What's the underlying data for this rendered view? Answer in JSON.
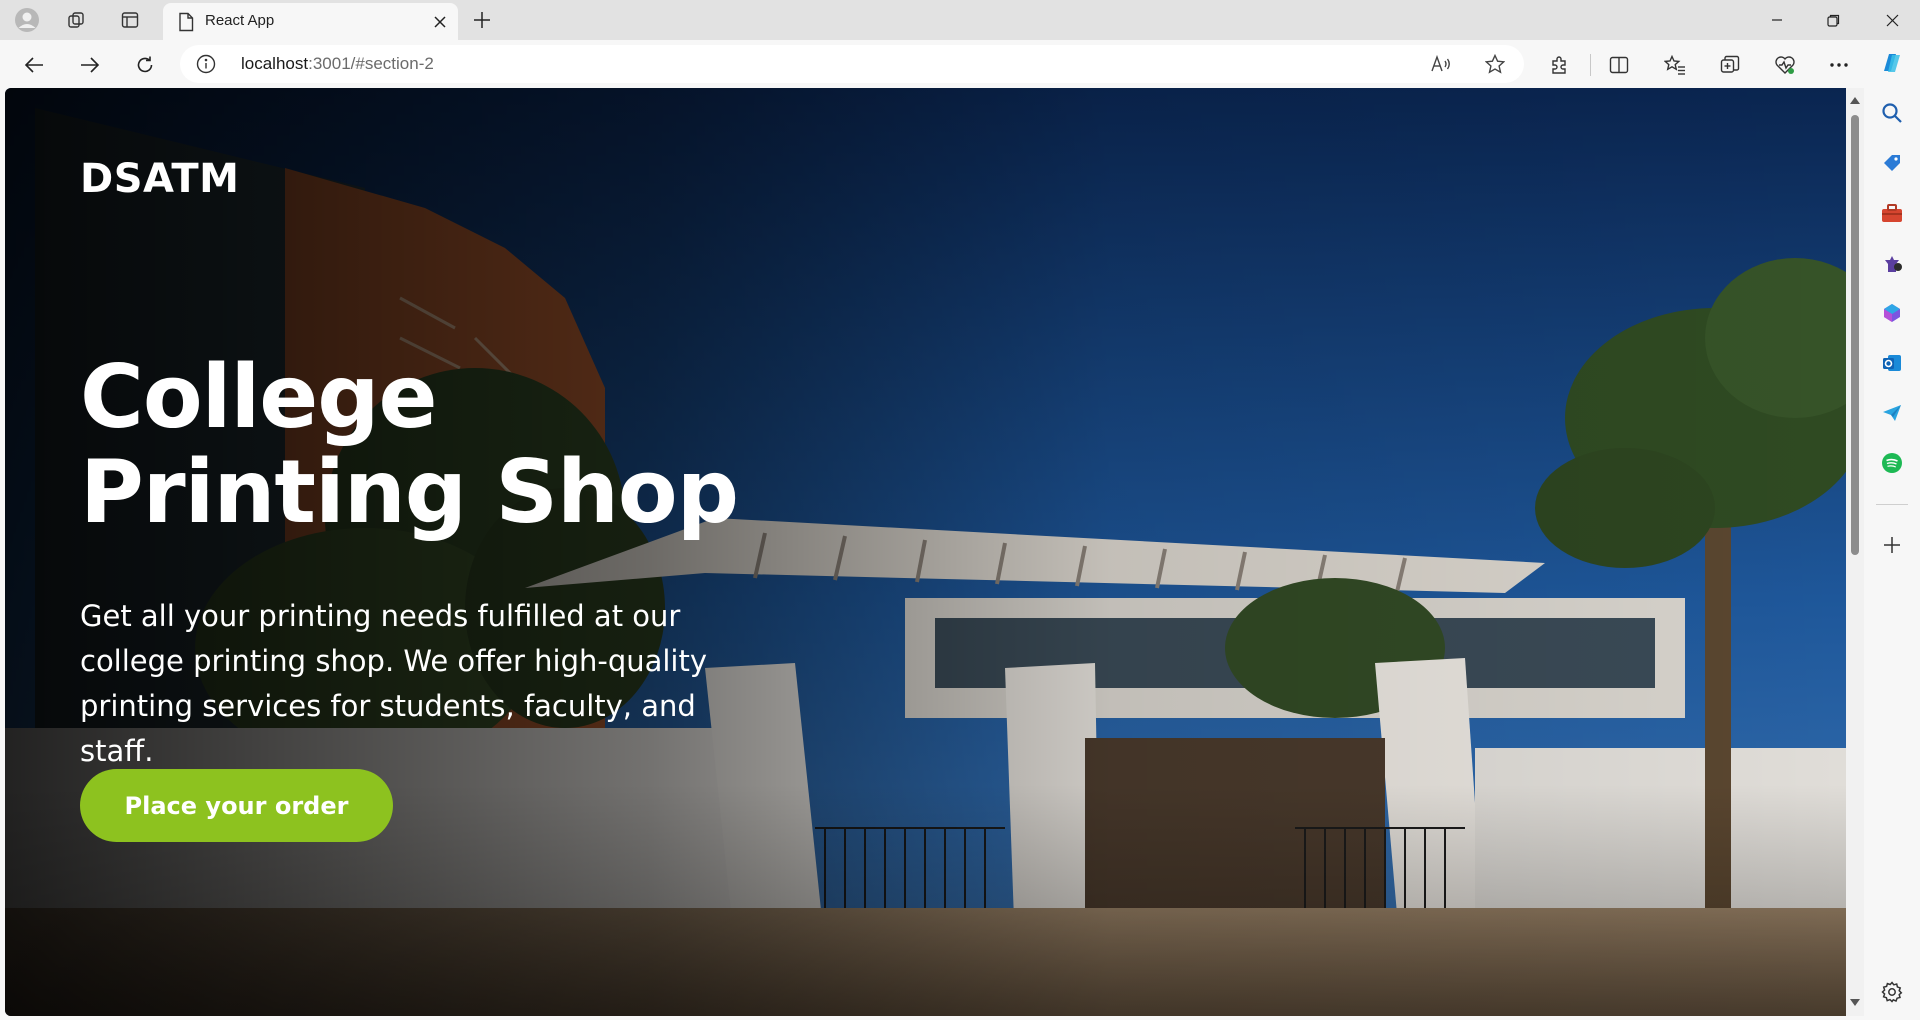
{
  "tab": {
    "title": "React App",
    "favicon": "document-icon"
  },
  "address_bar": {
    "host": "localhost",
    "rest": ":3001/#section-2"
  },
  "page": {
    "brand": "DSATM",
    "headline_line1": "College",
    "headline_line2": "Printing Shop",
    "description": "Get all your printing needs fulfilled at our college printing shop. We offer high-quality printing services for students, faculty, and staff.",
    "cta_label": "Place your order"
  },
  "colors": {
    "cta": "#8dc21f",
    "sky": "#1d4f8f",
    "browser_chrome": "#f7f7f7"
  },
  "sidebar_icons": [
    "search-icon",
    "shopping-tag-icon",
    "tools-icon",
    "games-icon",
    "copilot-icon",
    "outlook-icon",
    "telegram-icon",
    "spotify-icon",
    "add-icon",
    "settings-icon"
  ]
}
